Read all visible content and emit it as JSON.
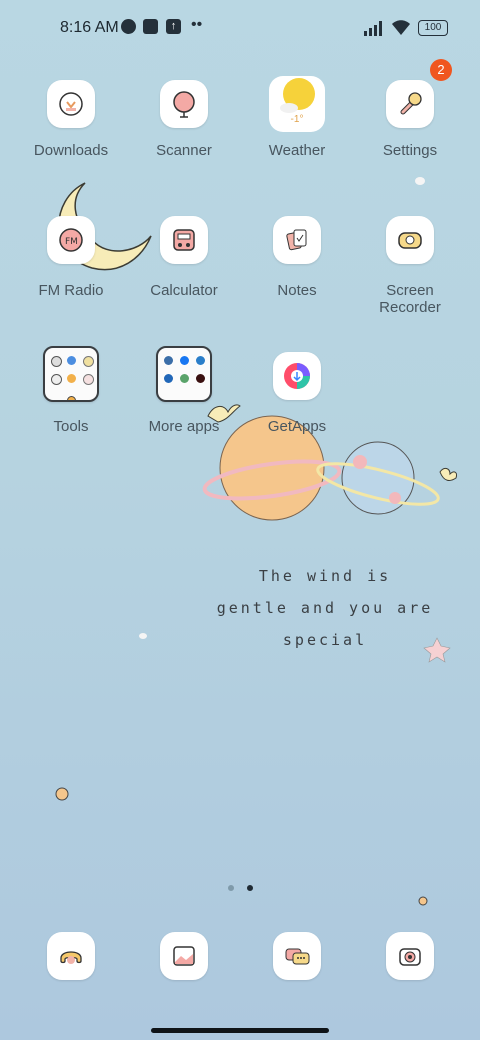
{
  "status_bar": {
    "time": "8:16 AM",
    "battery": "100",
    "icons": [
      "notification-app-icon",
      "square-app-icon",
      "upload-app-icon",
      "more-dots-icon",
      "signal-icon",
      "wifi-icon",
      "battery-icon"
    ]
  },
  "apps_row1": {
    "downloads": "Downloads",
    "scanner": "Scanner",
    "weather": "Weather",
    "weather_temp": "-1°",
    "settings": "Settings",
    "settings_badge": "2"
  },
  "apps_row2": {
    "fm_radio": "FM Radio",
    "calculator": "Calculator",
    "notes": "Notes",
    "screen_recorder_line1": "Screen",
    "screen_recorder_line2": "Recorder"
  },
  "apps_row3": {
    "tools": "Tools",
    "more_apps": "More apps",
    "getapps": "GetApps"
  },
  "wallpaper_text": {
    "line1": "The wind is",
    "line2": "gentle and you are",
    "line3": "special"
  },
  "page_indicator": {
    "pages": 2,
    "current": 2
  },
  "dock": [
    "phone-icon",
    "gallery-icon",
    "messages-icon",
    "camera-icon"
  ],
  "colors": {
    "badge": "#f0561f",
    "accent_orange": "#f4c48a",
    "accent_pink": "#f3a6a0",
    "moon": "#f7eab3"
  }
}
